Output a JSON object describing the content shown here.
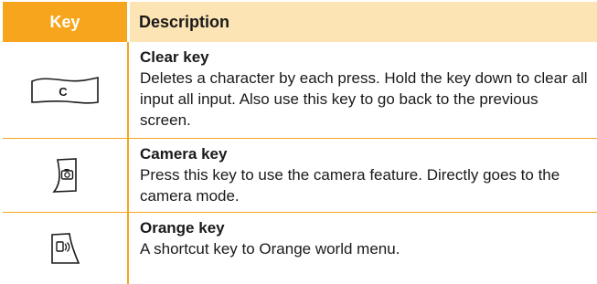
{
  "header": {
    "key": "Key",
    "description": "Description"
  },
  "rows": [
    {
      "icon": "clear-key-icon",
      "icon_label": "C",
      "title": "Clear key",
      "text": "Deletes a character by each press. Hold the key down to clear all input all input. Also use this key to go back to the previous screen."
    },
    {
      "icon": "camera-key-icon",
      "title": "Camera key",
      "text": "Press this key to use the camera feature. Directly goes to the camera mode."
    },
    {
      "icon": "orange-key-icon",
      "title": "Orange key",
      "text": "A shortcut key to Orange world menu."
    }
  ],
  "colors": {
    "accent": "#f7a51c",
    "header_desc_bg": "#fde4b5"
  }
}
